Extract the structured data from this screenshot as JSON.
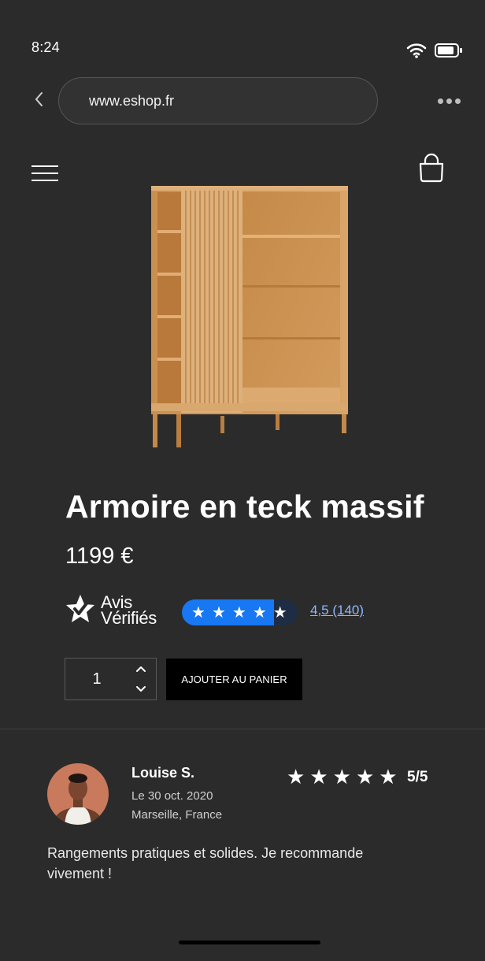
{
  "status_bar": {
    "time": "8:24",
    "wifi_icon": "wifi-icon",
    "battery_icon": "battery-icon"
  },
  "browser": {
    "url": "www.eshop.fr",
    "back_icon": "chevron-left-icon",
    "more_icon": "ellipsis-icon"
  },
  "header": {
    "menu_icon": "hamburger-menu-icon",
    "cart_icon": "shopping-bag-icon"
  },
  "product": {
    "image_subject": "wardrobe",
    "title": "Armoire en teck massif",
    "price": "1199 €",
    "rating": {
      "logo_line1": "Avis",
      "logo_line2": "Vérifiés",
      "stars": 4.5,
      "max_stars": 5,
      "summary": "4,5 (140)"
    },
    "quantity": "1",
    "add_to_cart_label": "AJOUTER AU PANIER"
  },
  "review": {
    "name": "Louise S.",
    "date": "Le 30 oct. 2020",
    "location": "Marseille, France",
    "stars": 5,
    "score": "5/5",
    "text": "Rangements pratiques et solides. Je recommande vivement !"
  },
  "colors": {
    "background": "#2b2b2b",
    "accent_blue": "#1877f2",
    "link": "#8fb6ff",
    "button": "#000000"
  }
}
